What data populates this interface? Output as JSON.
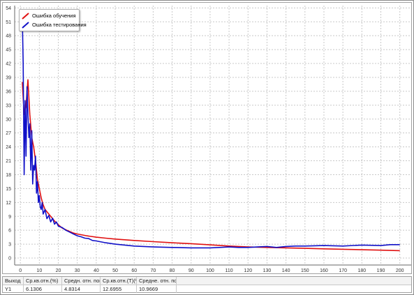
{
  "chart_data": {
    "type": "line",
    "title": "",
    "xlabel": "",
    "ylabel": "",
    "xlim": [
      -3,
      206
    ],
    "ylim": [
      -1.5,
      54.5
    ],
    "xticks": [
      0,
      10,
      20,
      30,
      40,
      50,
      60,
      70,
      80,
      90,
      100,
      110,
      120,
      130,
      140,
      150,
      160,
      170,
      180,
      190,
      200
    ],
    "yticks": [
      0,
      3,
      6,
      9,
      12,
      15,
      18,
      21,
      24,
      27,
      30,
      33,
      36,
      39,
      42,
      45,
      48,
      51,
      54
    ],
    "grid": true,
    "legend_position": "top-left",
    "series": [
      {
        "name": "Ошибка обучения",
        "color": "#e01010",
        "x": [
          1,
          2,
          3,
          4,
          5,
          6,
          7,
          8,
          9,
          10,
          11,
          12,
          13,
          14,
          15,
          16,
          18,
          20,
          22,
          25,
          28,
          30,
          35,
          40,
          45,
          50,
          60,
          70,
          80,
          90,
          100,
          110,
          120,
          130,
          140,
          150,
          160,
          170,
          180,
          190,
          200
        ],
        "y": [
          38,
          31,
          33,
          38.5,
          31,
          26,
          24,
          21,
          17,
          15,
          13,
          11.5,
          10.5,
          10,
          9.5,
          9,
          8,
          7.2,
          6.5,
          5.9,
          5.4,
          5.2,
          4.8,
          4.5,
          4.3,
          4.1,
          3.8,
          3.55,
          3.3,
          3.1,
          2.85,
          2.6,
          2.4,
          2.3,
          2.2,
          2.1,
          2.0,
          1.9,
          1.8,
          1.7,
          1.6
        ]
      },
      {
        "name": "Ошибка тестирования",
        "color": "#1010c8",
        "x": [
          1,
          1.5,
          2,
          2.5,
          3,
          3.5,
          4,
          4.5,
          5,
          5.5,
          6,
          6.5,
          7,
          7.5,
          8,
          8.5,
          9,
          9.5,
          10,
          10.5,
          11,
          11.5,
          12,
          13,
          14,
          15,
          16,
          17,
          18,
          19,
          20,
          22,
          24,
          26,
          28,
          30,
          32,
          34,
          36,
          38,
          40,
          45,
          50,
          55,
          60,
          70,
          80,
          90,
          100,
          105,
          110,
          115,
          120,
          125,
          130,
          135,
          140,
          145,
          150,
          160,
          170,
          180,
          190,
          195,
          200
        ],
        "y": [
          52.5,
          42,
          18,
          34,
          22,
          37,
          31,
          26,
          29,
          19,
          27.5,
          16,
          20,
          19,
          22,
          14,
          16.5,
          12,
          13.5,
          11,
          10.5,
          12,
          9.5,
          10.5,
          8.5,
          9.2,
          7.8,
          8.6,
          7.3,
          7.8,
          6.9,
          6.6,
          6.0,
          5.6,
          5.2,
          4.8,
          4.6,
          4.3,
          4.2,
          3.8,
          3.7,
          3.3,
          3.0,
          2.8,
          2.6,
          2.4,
          2.3,
          2.2,
          2.2,
          2.3,
          2.4,
          2.3,
          2.3,
          2.4,
          2.5,
          2.3,
          2.5,
          2.6,
          2.6,
          2.7,
          2.6,
          2.8,
          2.7,
          2.9,
          2.9
        ]
      }
    ]
  },
  "legend": {
    "items": [
      {
        "label": "Ошибка обучения",
        "color": "#e01010"
      },
      {
        "label": "Ошибка тестирования",
        "color": "#1010c8"
      }
    ]
  },
  "table": {
    "headers": [
      "Выход",
      "Ср.кв.отн.(%)",
      "Средн. отн. погр",
      "Ср.кв.отн.(T)(%)",
      "Средне. отн. пог"
    ],
    "row": [
      "Y1",
      "6.1306",
      "4.8314",
      "12.6955",
      "10.9669"
    ]
  }
}
